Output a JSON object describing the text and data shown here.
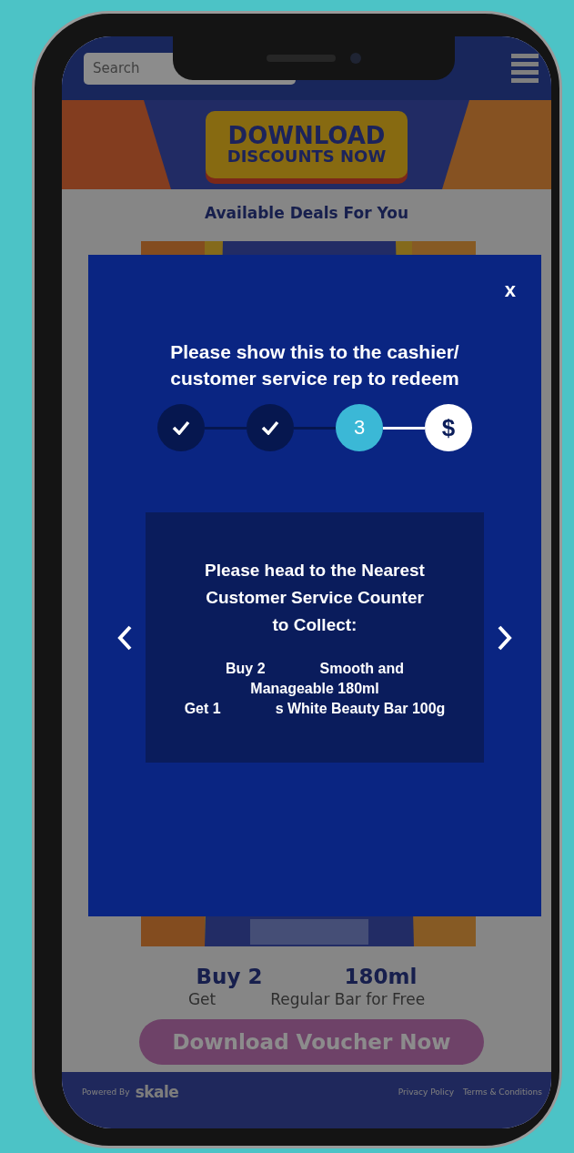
{
  "header": {
    "search": {
      "placeholder": "Search"
    }
  },
  "banner": {
    "lines": [
      "DOWNLOAD",
      "DISCOUNTS NOW"
    ]
  },
  "section_title": "Available Deals For You",
  "deal": {
    "image": {
      "kind": "picture"
    },
    "headline": [
      "Buy 2",
      "180ml"
    ],
    "subline": [
      "Get",
      "Regular Bar for Free"
    ],
    "button": "Download Voucher Now"
  },
  "footer": {
    "powered_by": "Powered By",
    "brand": "skale",
    "links": [
      "Privacy Policy",
      "Terms & Conditions"
    ]
  },
  "modal": {
    "close": "x",
    "title": "Please show this to the cashier/ customer service rep to redeem",
    "steps": [
      {
        "kind": "check",
        "done": true,
        "selected": false
      },
      {
        "kind": "check",
        "done": true,
        "selected": false
      },
      {
        "kind": "number",
        "label": "3",
        "done": false,
        "selected": true
      },
      {
        "kind": "reward",
        "label": "$",
        "done": false,
        "selected": false
      }
    ],
    "card": {
      "heading": "Please head to the Nearest Customer Service Counter to Collect:",
      "lines": [
        [
          "Buy 2",
          "Smooth and"
        ],
        [
          "Manageable 180ml"
        ],
        [
          "Get 1",
          "s White Beauty Bar 100g"
        ]
      ]
    }
  }
}
